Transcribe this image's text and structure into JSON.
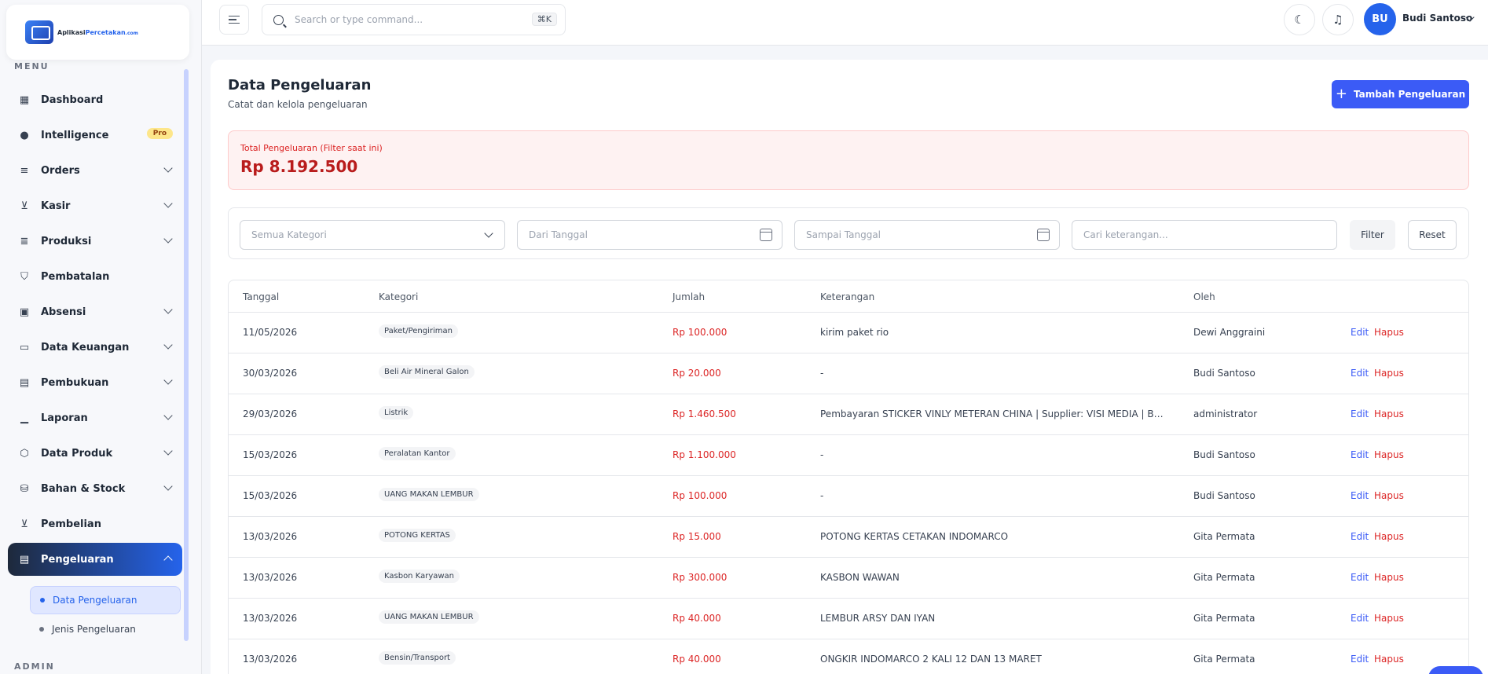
{
  "brand": {
    "name_part1": "Aplikasi",
    "name_part2": "Percetakan",
    "name_part3": ".com"
  },
  "sidebar": {
    "menu_heading": "MENU",
    "admin_heading": "ADMIN",
    "items": [
      {
        "label": "Dashboard",
        "icon": "dashboard-icon"
      },
      {
        "label": "Intelligence",
        "icon": "brain-icon",
        "badge": "Pro"
      },
      {
        "label": "Orders",
        "icon": "orders-icon"
      },
      {
        "label": "Kasir",
        "icon": "cart-icon"
      },
      {
        "label": "Produksi",
        "icon": "production-icon"
      },
      {
        "label": "Pembatalan",
        "icon": "shield-icon"
      },
      {
        "label": "Absensi",
        "icon": "calendar-check-icon"
      },
      {
        "label": "Data Keuangan",
        "icon": "wallet-icon"
      },
      {
        "label": "Pembukuan",
        "icon": "book-icon"
      },
      {
        "label": "Laporan",
        "icon": "bar-chart-icon"
      },
      {
        "label": "Data Produk",
        "icon": "box-icon"
      },
      {
        "label": "Bahan & Stock",
        "icon": "database-icon"
      },
      {
        "label": "Pembelian",
        "icon": "cart-icon"
      },
      {
        "label": "Pengeluaran",
        "icon": "receipt-icon"
      }
    ],
    "sub_items": [
      {
        "label": "Data Pengeluaran"
      },
      {
        "label": "Jenis Pengeluaran"
      }
    ]
  },
  "topbar": {
    "search_placeholder": "Search or type command...",
    "shortcut": "⌘K",
    "avatar_initials": "BU",
    "user_name": "Budi Santoso"
  },
  "page": {
    "title": "Data Pengeluaran",
    "subtitle": "Catat dan kelola pengeluaran",
    "add_button": "Tambah Pengeluaran",
    "total_label": "Total Pengeluaran (Filter saat ini)",
    "total_value": "Rp 8.192.500"
  },
  "filters": {
    "category_placeholder": "Semua Kategori",
    "from_date_placeholder": "Dari Tanggal",
    "to_date_placeholder": "Sampai Tanggal",
    "search_placeholder": "Cari keterangan...",
    "filter_button": "Filter",
    "reset_button": "Reset"
  },
  "table": {
    "headers": [
      "Tanggal",
      "Kategori",
      "Jumlah",
      "Keterangan",
      "Oleh"
    ],
    "edit_label": "Edit",
    "delete_label": "Hapus",
    "rows": [
      {
        "tanggal": "11/05/2026",
        "kategori": "Paket/Pengiriman",
        "jumlah": "Rp 100.000",
        "keterangan": "kirim paket rio",
        "oleh": "Dewi Anggraini"
      },
      {
        "tanggal": "30/03/2026",
        "kategori": "Beli Air Mineral Galon",
        "jumlah": "Rp 20.000",
        "keterangan": "-",
        "oleh": "Budi Santoso"
      },
      {
        "tanggal": "29/03/2026",
        "kategori": "Listrik",
        "jumlah": "Rp 1.460.500",
        "keterangan": "Pembayaran STICKER VINLY METERAN CHINA | Supplier: VISI MEDIA | Bank ...",
        "oleh": "administrator"
      },
      {
        "tanggal": "15/03/2026",
        "kategori": "Peralatan Kantor",
        "jumlah": "Rp 1.100.000",
        "keterangan": "-",
        "oleh": "Budi Santoso"
      },
      {
        "tanggal": "15/03/2026",
        "kategori": "UANG MAKAN LEMBUR",
        "jumlah": "Rp 100.000",
        "keterangan": "-",
        "oleh": "Budi Santoso"
      },
      {
        "tanggal": "13/03/2026",
        "kategori": "POTONG KERTAS",
        "jumlah": "Rp 15.000",
        "keterangan": "POTONG KERTAS CETAKAN INDOMARCO",
        "oleh": "Gita Permata"
      },
      {
        "tanggal": "13/03/2026",
        "kategori": "Kasbon Karyawan",
        "jumlah": "Rp 300.000",
        "keterangan": "KASBON WAWAN",
        "oleh": "Gita Permata"
      },
      {
        "tanggal": "13/03/2026",
        "kategori": "UANG MAKAN LEMBUR",
        "jumlah": "Rp 40.000",
        "keterangan": "LEMBUR ARSY DAN IYAN",
        "oleh": "Gita Permata"
      },
      {
        "tanggal": "13/03/2026",
        "kategori": "Bensin/Transport",
        "jumlah": "Rp 40.000",
        "keterangan": "ONGKIR INDOMARCO 2 KALI 12 DAN 13 MARET",
        "oleh": "Gita Permata"
      }
    ]
  }
}
